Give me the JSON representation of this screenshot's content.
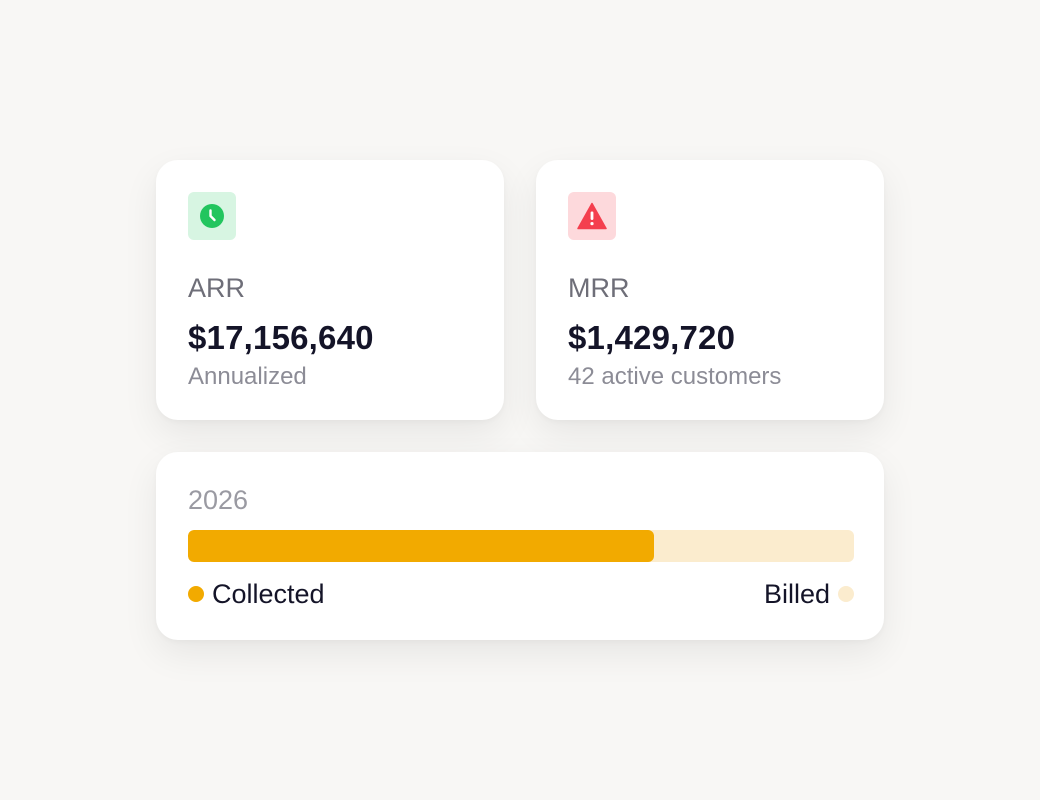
{
  "cards": [
    {
      "label": "ARR",
      "value": "$17,156,640",
      "sub": "Annualized",
      "icon": "clock-icon",
      "icon_bg": "#d7f5e2",
      "icon_color": "#22c55e"
    },
    {
      "label": "MRR",
      "value": "$1,429,720",
      "sub": "42 active customers",
      "icon": "warning-icon",
      "icon_bg": "#fdd9dc",
      "icon_color": "#f43f4e"
    }
  ],
  "progress": {
    "year": "2026",
    "collected_fraction": 0.7,
    "collected_label": "Collected",
    "billed_label": "Billed",
    "collected_color": "#f2aa00",
    "billed_color": "#fbecce"
  }
}
